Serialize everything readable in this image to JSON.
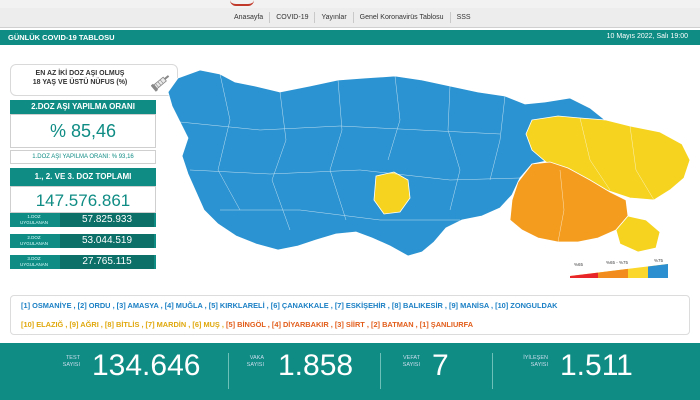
{
  "nav": {
    "items": [
      "Anasayfa",
      "COVID-19",
      "Yayınlar",
      "Genel Koronavirüs Tablosu",
      "SSS"
    ]
  },
  "header": {
    "title": "GÜNLÜK COVID-19 TABLOSU",
    "date": "10 Mayıs 2022, Salı 19:00"
  },
  "vaccination": {
    "heading_line1": "EN AZ İKİ DOZ AŞI OLMUŞ",
    "heading_line2": "18 YAŞ VE ÜSTÜ NÜFUS (%)",
    "rate_title": "2.DOZ AŞI YAPILMA ORANI",
    "rate_value": "% 85,46",
    "dose1_note": "1.DOZ AŞI YAPILMA ORANI: % 93,16",
    "total_title": "1., 2. VE 3. DOZ TOPLAMI",
    "total_value": "147.576.861",
    "doses": [
      {
        "label1": "1.DOZ",
        "label2": "UYGULANAN",
        "value": "57.825.933"
      },
      {
        "label1": "2.DOZ",
        "label2": "UYGULANAN",
        "value": "53.044.519"
      },
      {
        "label1": "3.DOZ",
        "label2": "UYGULANAN",
        "value": "27.765.115"
      }
    ]
  },
  "legend": {
    "items": [
      "%65",
      "%65 - %75",
      "%75"
    ],
    "colors": [
      "#e8262a",
      "#f28c1c",
      "#fbd72b",
      "#2b8fd0"
    ]
  },
  "colors": {
    "blue": "#2b93d1",
    "yellow": "#f5d31f",
    "orange": "#f39c1e",
    "teal": "#0f8c84"
  },
  "provinces": {
    "line1": "[1] OSMANİYE , [2] ORDU , [3] AMASYA , [4] MUĞLA , [5] KIRKLARELİ , [6] ÇANAKKALE , [7] ESKİŞEHİR , [8] BALIKESİR , [9] MANİSA , [10] ZONGULDAK",
    "line2_a": "[10] ELAZIĞ , [9] AĞRI , [8] BİTLİS , [7] MARDİN , [6] MUŞ , ",
    "line2_b": "[5] BİNGÖL , [4] DİYARBAKIR , [3] SİİRT , [2] BATMAN , [1] ŞANLIURFA"
  },
  "stats": [
    {
      "label1": "TEST",
      "label2": "SAYISI",
      "value": "134.646"
    },
    {
      "label1": "VAKA",
      "label2": "SAYISI",
      "value": "1.858"
    },
    {
      "label1": "VEFAT",
      "label2": "SAYISI",
      "value": "7"
    },
    {
      "label1": "İYİLEŞEN",
      "label2": "SAYISI",
      "value": "1.511"
    }
  ]
}
